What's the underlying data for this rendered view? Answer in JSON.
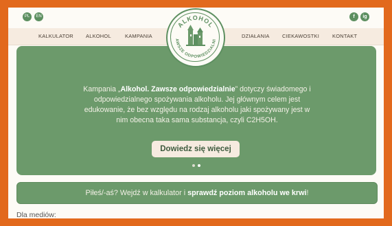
{
  "top_bar": {
    "languages": [
      "PL",
      "EN"
    ],
    "social": [
      "f",
      "ig"
    ]
  },
  "nav": {
    "left": [
      "KALKULATOR",
      "ALKOHOL",
      "KAMPANIA"
    ],
    "right": [
      "DZIAŁANIA",
      "CIEKAWOSTKI",
      "KONTAKT"
    ]
  },
  "logo": {
    "top_text": "ALKOHOL",
    "bottom_text": "ZAWSZE ODPOWIEDZIALNIE"
  },
  "hero": {
    "line1_pre": "Kampania „",
    "line1_bold": "Alkohol. Zawsze odpowiedzialnie",
    "line1_post": "” dotyczy świadomego i",
    "line2": "odpowiedzialnego spożywania alkoholu. Jej głównym celem jest",
    "line3": "edukowanie, że bez względu na rodzaj alkoholu jaki spożywany jest w",
    "line4": "nim obecna taka sama substancja, czyli C2H5OH.",
    "cta_label": "Dowiedz się więcej"
  },
  "banner": {
    "text_pre": "Piłeś/-aś? Wejdź w kalkulator i ",
    "text_bold": "sprawdź poziom alkoholu we krwi",
    "text_post": "!"
  },
  "media": {
    "label": "Dla mediów:"
  },
  "colors": {
    "frame": "#e2691d",
    "green": "#6c9a6b",
    "cream": "#f6ebe0"
  }
}
